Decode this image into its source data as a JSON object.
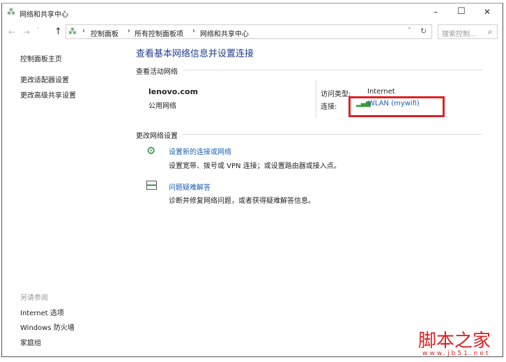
{
  "window": {
    "title": "网络和共享中心",
    "minimize": "–",
    "maximize": "☐",
    "close": "✕"
  },
  "nav": {
    "back": "←",
    "forward": "→",
    "recent": "˅",
    "up": "↑",
    "breadcrumb": [
      "控制面板",
      "所有控制面板项",
      "网络和共享中心"
    ],
    "sep": "›",
    "dropdown": "˅",
    "refresh": "↻",
    "search_placeholder": "搜索控制...",
    "search_icon": "⌕"
  },
  "sidebar": {
    "items": [
      "控制面板主页",
      "更改适配器设置",
      "更改高级共享设置"
    ],
    "see_also_label": "另请参阅",
    "see_also": [
      "Internet 选项",
      "Windows 防火墙",
      "家庭组"
    ]
  },
  "main": {
    "title": "查看基本网络信息并设置连接",
    "active_label": "查看活动网络",
    "network_name": "lenovo.com",
    "network_type": "公用网络",
    "access_type_label": "访问类型:",
    "access_type": "Internet",
    "connection_label": "连接:",
    "connection": "WLAN (mywifi)",
    "change_label": "更改网络设置",
    "tasks": [
      {
        "title": "设置新的连接或网络",
        "desc": "设置宽带、拨号或 VPN 连接；或设置路由器或接入点。"
      },
      {
        "title": "问题疑难解答",
        "desc": "诊断并修复网络问题，或者获得疑难解答信息。"
      }
    ]
  },
  "watermark": {
    "title": "脚本之家",
    "url": "www.jb51.net"
  },
  "colors": {
    "link": "#1a5fb4",
    "title": "#1e3c8c",
    "highlight": "#e02020"
  }
}
